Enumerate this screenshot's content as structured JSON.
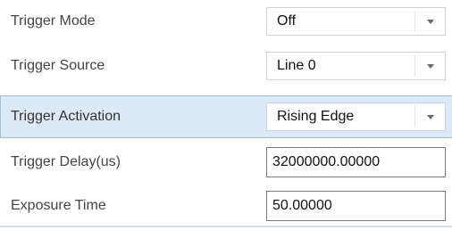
{
  "properties": [
    {
      "label": "Trigger Mode",
      "value": "Off",
      "control": "dropdown"
    },
    {
      "label": "Trigger Source",
      "value": "Line 0",
      "control": "dropdown"
    },
    {
      "label": "Trigger Activation",
      "value": "Rising Edge",
      "control": "dropdown",
      "selected": true
    },
    {
      "label": "Trigger Delay(us)",
      "value": "32000000.00000",
      "control": "textbox"
    },
    {
      "label": "Exposure Time",
      "value": "50.00000",
      "control": "textbox"
    }
  ],
  "icons": {
    "dropdown_arrow": "chevron-down-icon"
  },
  "colors": {
    "selected_row_bg": "#dceaf7",
    "selected_row_border": "#9fc0e0",
    "label_text": "#444444"
  }
}
